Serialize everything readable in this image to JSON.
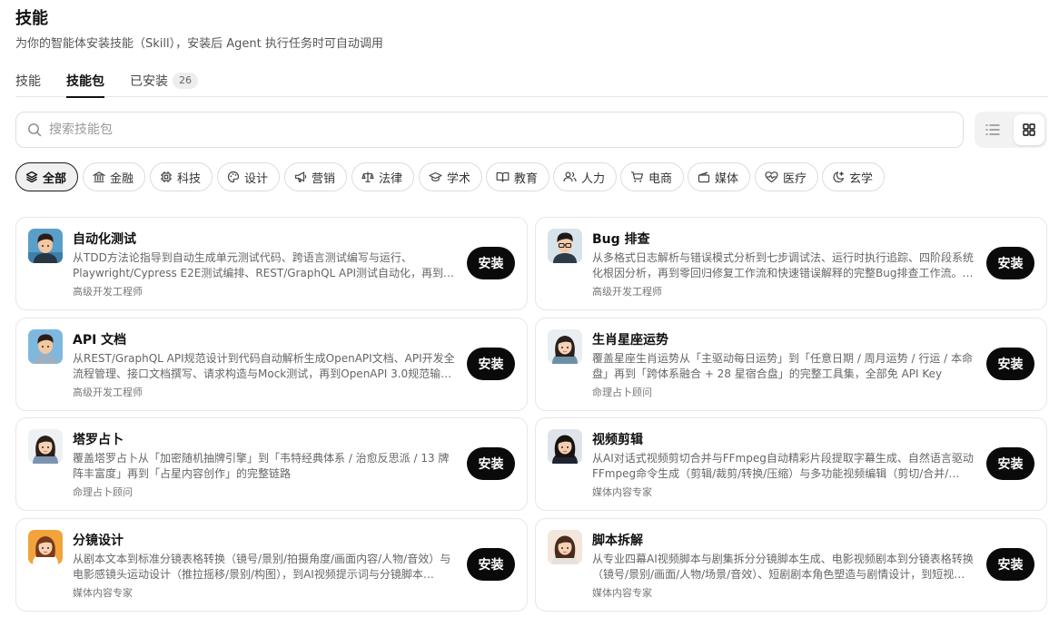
{
  "header": {
    "title": "技能",
    "subtitle": "为你的智能体安装技能（Skill），安装后 Agent 执行任务时可自动调用"
  },
  "tabs": [
    {
      "label": "技能"
    },
    {
      "label": "技能包"
    },
    {
      "label": "已安装",
      "badge": "26"
    }
  ],
  "active_tab": "技能包",
  "search": {
    "placeholder": "搜索技能包",
    "value": ""
  },
  "view_toggle": {
    "options": [
      "list",
      "grid"
    ],
    "selected": "grid"
  },
  "categories": [
    {
      "label": "全部",
      "icon": "layers-icon"
    },
    {
      "label": "金融",
      "icon": "bank-icon"
    },
    {
      "label": "科技",
      "icon": "chip-icon"
    },
    {
      "label": "设计",
      "icon": "palette-icon"
    },
    {
      "label": "营销",
      "icon": "megaphone-icon"
    },
    {
      "label": "法律",
      "icon": "scales-icon"
    },
    {
      "label": "学术",
      "icon": "graduation-cap-icon"
    },
    {
      "label": "教育",
      "icon": "book-icon"
    },
    {
      "label": "人力",
      "icon": "users-icon"
    },
    {
      "label": "电商",
      "icon": "cart-icon"
    },
    {
      "label": "媒体",
      "icon": "media-icon"
    },
    {
      "label": "医疗",
      "icon": "heart-pulse-icon"
    },
    {
      "label": "玄学",
      "icon": "moon-icon"
    }
  ],
  "active_category": "全部",
  "install_label": "安装",
  "skills": [
    {
      "title": "自动化测试",
      "description": "从TDD方法论指导到自动生成单元测试代码、跨语言测试编写与运行、Playwright/Cypress E2E测试编排、REST/GraphQL API测试自动化，再到Q…",
      "author": "高级开发工程师",
      "avatar": "developer-avatar-icon"
    },
    {
      "title": "Bug 排查",
      "description": "从多格式日志解析与错误模式分析到七步调试法、运行时执行追踪、四阶段系统化根因分析，再到零回归修复工作流和快速错误解释的完整Bug排查工作流。…",
      "author": "高级开发工程师",
      "avatar": "developer-glasses-avatar-icon"
    },
    {
      "title": "API 文档",
      "description": "从REST/GraphQL API规范设计到代码自动解析生成OpenAPI文档、API开发全流程管理、接口文档撰写、请求构造与Mock测试，再到OpenAPI 3.0规范输…",
      "author": "高级开发工程师",
      "avatar": "developer-avatar-icon"
    },
    {
      "title": "生肖星座运势",
      "description": "覆盖星座生肖运势从「主驱动每日运势」到「任意日期 / 周月运势 / 行运 / 本命盘」再到「跨体系融合 + 28 星宿合盘」的完整工具集，全部免 API Key",
      "author": "命理占卜顾问",
      "avatar": "fortune-teller-avatar-icon"
    },
    {
      "title": "塔罗占卜",
      "description": "覆盖塔罗占卜从「加密随机抽牌引擎」到「韦特经典体系 / 治愈反思派 / 13 牌阵丰富度」再到「占星内容创作」的完整链路",
      "author": "命理占卜顾问",
      "avatar": "fortune-teller-avatar-icon"
    },
    {
      "title": "视频剪辑",
      "description": "从AI对话式视频剪切合并与FFmpeg自动精彩片段提取字幕生成、自然语言驱动FFmpeg命令生成（剪辑/裁剪/转换/压缩）与多功能视频编辑（剪切/合并/…",
      "author": "媒体内容专家",
      "avatar": "media-expert-avatar-icon"
    },
    {
      "title": "分镜设计",
      "description": "从剧本文本到标准分镜表格转换（镜号/景别/拍摄角度/画面内容/人物/音效）与电影感镜头运动设计（推拉摇移/景别/构图），到AI视频提示词与分镜脚本…",
      "author": "媒体内容专家",
      "avatar": "media-expert-avatar-icon"
    },
    {
      "title": "脚本拆解",
      "description": "从专业四幕AI视频脚本与剧集拆分分镜脚本生成、电影视频剧本到分镜表格转换（镜号/景别/画面/人物/场景/音效）、短剧剧本角色塑造与剧情设计，到短视…",
      "author": "媒体内容专家",
      "avatar": "media-expert-avatar-icon"
    }
  ]
}
